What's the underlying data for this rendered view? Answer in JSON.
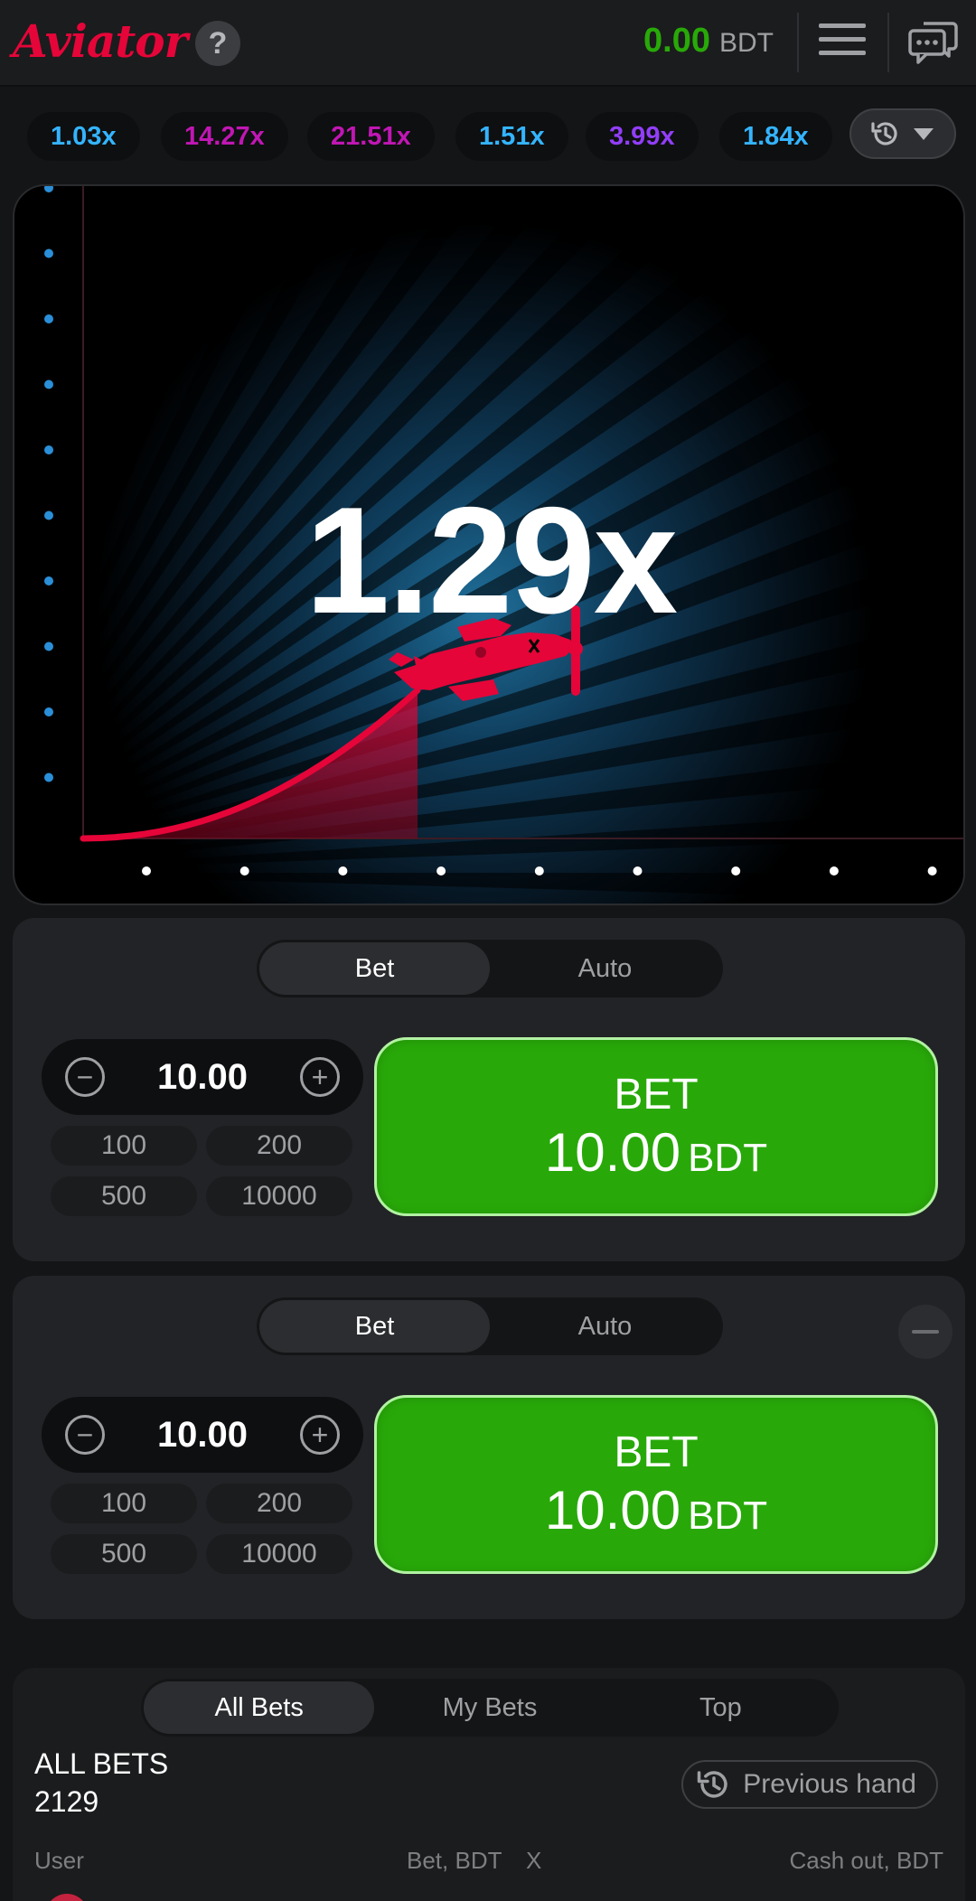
{
  "header": {
    "logo_text": "Aviator",
    "help_label": "?",
    "balance_amount": "0.00",
    "balance_currency": "BDT"
  },
  "history": {
    "items": [
      {
        "value": "1.03x",
        "color": "#34b4ff"
      },
      {
        "value": "14.27x",
        "color": "#c017b4"
      },
      {
        "value": "21.51x",
        "color": "#c017b4"
      },
      {
        "value": "1.51x",
        "color": "#34b4ff"
      },
      {
        "value": "3.99x",
        "color": "#913ef8"
      },
      {
        "value": "1.84x",
        "color": "#34b4ff"
      }
    ],
    "toggle_icon": "history-icon"
  },
  "game": {
    "multiplier": "1.29x",
    "plane_color": "#e50539"
  },
  "bet_panels": [
    {
      "tabs": [
        "Bet",
        "Auto"
      ],
      "active_tab": "Bet",
      "amount": "10.00",
      "quick_amounts": [
        "100",
        "200",
        "500",
        "10000"
      ],
      "button_label": "BET",
      "button_amount": "10.00",
      "button_currency": "BDT"
    },
    {
      "tabs": [
        "Bet",
        "Auto"
      ],
      "active_tab": "Bet",
      "amount": "10.00",
      "quick_amounts": [
        "100",
        "200",
        "500",
        "10000"
      ],
      "button_label": "BET",
      "button_amount": "10.00",
      "button_currency": "BDT"
    }
  ],
  "bets": {
    "tabs": [
      "All Bets",
      "My Bets",
      "Top"
    ],
    "active_tab": "All Bets",
    "title": "ALL BETS",
    "count": "2129",
    "previous_hand_label": "Previous hand",
    "columns": [
      "User",
      "Bet, BDT",
      "X",
      "Cash out, BDT"
    ]
  },
  "colors": {
    "accent_green": "#28a909",
    "accent_red": "#e50539",
    "background": "#141516"
  }
}
